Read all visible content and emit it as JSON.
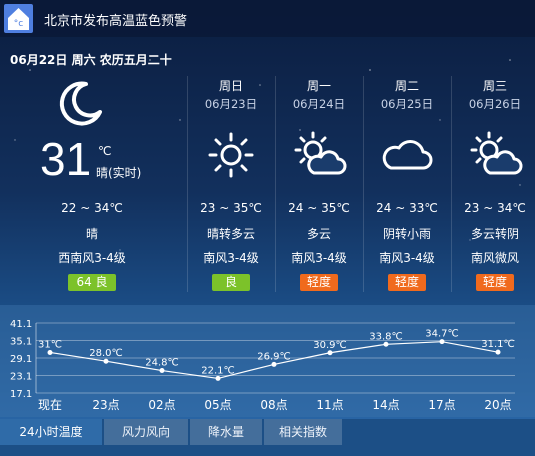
{
  "alert": {
    "icon": "thermometer-celsius-icon",
    "text": "北京市发布高温蓝色预警"
  },
  "current": {
    "date_line": "06月22日 周六 农历五月二十",
    "icon": "crescent-moon-icon",
    "temp": "31",
    "unit": "℃",
    "label": "晴(实时)",
    "range": "22 ~ 34℃",
    "weather": "晴",
    "wind": "西南风3-4级",
    "aqi_value": "64",
    "aqi_level": "良",
    "aqi_color": "#7cc22a"
  },
  "forecast": [
    {
      "day": "周日",
      "date": "06月23日",
      "icon": "sun-icon",
      "range": "23 ~ 35℃",
      "weather": "晴转多云",
      "wind": "南风3-4级",
      "aqi": "良",
      "aqi_color": "#7cc22a"
    },
    {
      "day": "周一",
      "date": "06月24日",
      "icon": "partly-cloudy-icon",
      "range": "24 ~ 35℃",
      "weather": "多云",
      "wind": "南风3-4级",
      "aqi": "轻度",
      "aqi_color": "#f06a1d"
    },
    {
      "day": "周二",
      "date": "06月25日",
      "icon": "cloud-icon",
      "range": "24 ~ 33℃",
      "weather": "阴转小雨",
      "wind": "南风3-4级",
      "aqi": "轻度",
      "aqi_color": "#f06a1d"
    },
    {
      "day": "周三",
      "date": "06月26日",
      "icon": "partly-cloudy-icon",
      "range": "23 ~ 34℃",
      "weather": "多云转阴",
      "wind": "南风微风",
      "aqi": "轻度",
      "aqi_color": "#f06a1d"
    }
  ],
  "chart_data": {
    "type": "line",
    "title": "",
    "xlabel": "",
    "ylabel": "",
    "categories": [
      "现在",
      "23点",
      "02点",
      "05点",
      "08点",
      "11点",
      "14点",
      "17点",
      "20点"
    ],
    "values": [
      31,
      28.0,
      24.8,
      22.1,
      26.9,
      30.9,
      33.8,
      34.7,
      31.1
    ],
    "point_labels": [
      "31℃",
      "28.0℃",
      "24.8℃",
      "22.1℃",
      "26.9℃",
      "30.9℃",
      "33.8℃",
      "34.7℃",
      "31.1℃"
    ],
    "yticks": [
      "41.1",
      "35.1",
      "29.1",
      "23.1",
      "17.1"
    ],
    "ytick_values": [
      41.1,
      35.1,
      29.1,
      23.1,
      17.1
    ],
    "ylim": [
      17.1,
      41.1
    ],
    "grid": true
  },
  "tabs": [
    "24小时温度",
    "风力风向",
    "降水量",
    "相关指数"
  ]
}
